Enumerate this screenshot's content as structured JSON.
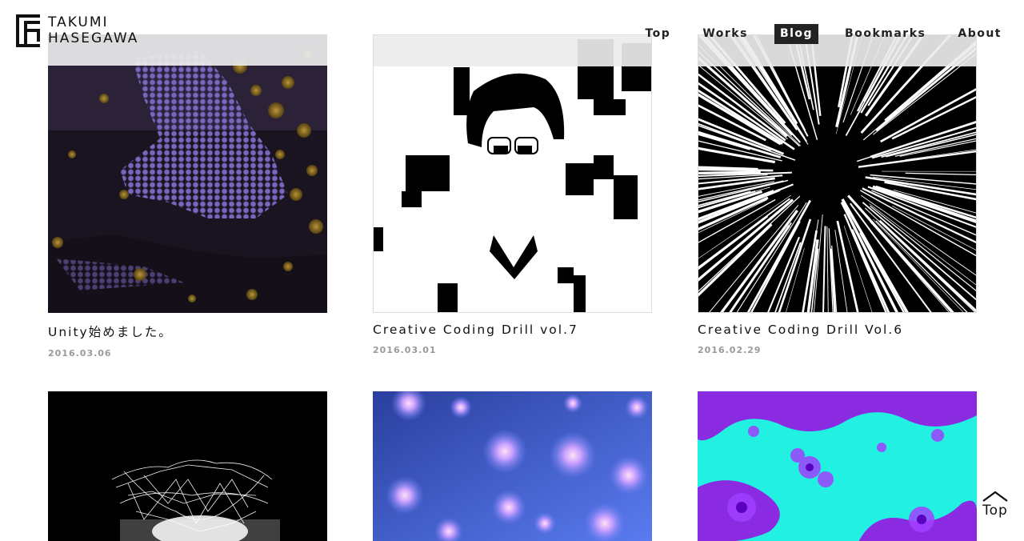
{
  "site": {
    "name_line1": "TAKUMI",
    "name_line2": "HASEGAWA"
  },
  "nav": {
    "items": [
      {
        "label": "Top",
        "active": false
      },
      {
        "label": "Works",
        "active": false
      },
      {
        "label": "Blog",
        "active": true
      },
      {
        "label": "Bookmarks",
        "active": false
      },
      {
        "label": "About",
        "active": false
      }
    ]
  },
  "posts": [
    {
      "title": "Unity始めました。",
      "date": "2016.03.06",
      "thumb": "hexagon-particles-purple"
    },
    {
      "title": "Creative Coding Drill vol.7",
      "date": "2016.03.01",
      "thumb": "pixelated-portrait-bw"
    },
    {
      "title": "Creative Coding Drill Vol.6",
      "date": "2016.02.29",
      "thumb": "radial-speed-lines"
    },
    {
      "thumb": "white-fractal-tree-on-black"
    },
    {
      "thumb": "blue-julia-fractals"
    },
    {
      "thumb": "cyan-purple-mandelbrot"
    }
  ],
  "back_to_top": {
    "label": "Top",
    "icon": "chevron-up-icon"
  },
  "colors": {
    "text": "#111111",
    "date": "#9a9a9a",
    "active_nav_bg": "#222222"
  }
}
